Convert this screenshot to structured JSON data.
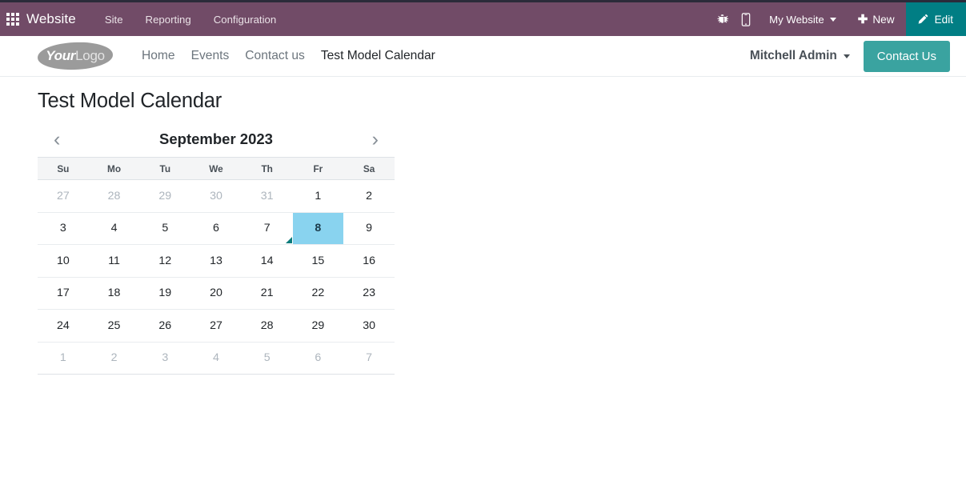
{
  "backend_navbar": {
    "apps_icon": "apps-grid-icon",
    "brand": "Website",
    "menu_items": [
      {
        "label": "Site"
      },
      {
        "label": "Reporting"
      },
      {
        "label": "Configuration"
      }
    ],
    "debug_icon": "bug-icon",
    "mobile_icon": "mobile-preview-icon",
    "website_switcher": "My Website",
    "new_label": "New",
    "new_icon": "plus-icon",
    "edit_label": "Edit",
    "edit_icon": "pencil-icon",
    "colors": {
      "navbar_bg": "#714B67",
      "edit_btn_bg": "#017e84"
    }
  },
  "site_header": {
    "logo_part1": "Your",
    "logo_part2": "Logo",
    "nav": [
      {
        "label": "Home",
        "active": false
      },
      {
        "label": "Events",
        "active": false
      },
      {
        "label": "Contact us",
        "active": false
      },
      {
        "label": "Test Model Calendar",
        "active": true
      }
    ],
    "user_name": "Mitchell Admin",
    "cta_label": "Contact Us",
    "colors": {
      "cta_bg": "#3aa3a0"
    }
  },
  "page": {
    "title": "Test Model Calendar"
  },
  "calendar": {
    "prev_icon": "chevron-left-icon",
    "next_icon": "chevron-right-icon",
    "month_label": "September 2023",
    "weekday_headers": [
      "Su",
      "Mo",
      "Tu",
      "We",
      "Th",
      "Fr",
      "Sa"
    ],
    "selected_day": 8,
    "selected_color": "#89d3ef",
    "marker_color": "#0b7b7b",
    "weeks": [
      [
        {
          "day": 27,
          "muted": true,
          "selected": false,
          "marker": false
        },
        {
          "day": 28,
          "muted": true,
          "selected": false,
          "marker": false
        },
        {
          "day": 29,
          "muted": true,
          "selected": false,
          "marker": false
        },
        {
          "day": 30,
          "muted": true,
          "selected": false,
          "marker": false
        },
        {
          "day": 31,
          "muted": true,
          "selected": false,
          "marker": false
        },
        {
          "day": 1,
          "muted": false,
          "selected": false,
          "marker": false
        },
        {
          "day": 2,
          "muted": false,
          "selected": false,
          "marker": false
        }
      ],
      [
        {
          "day": 3,
          "muted": false,
          "selected": false,
          "marker": false
        },
        {
          "day": 4,
          "muted": false,
          "selected": false,
          "marker": false
        },
        {
          "day": 5,
          "muted": false,
          "selected": false,
          "marker": false
        },
        {
          "day": 6,
          "muted": false,
          "selected": false,
          "marker": false
        },
        {
          "day": 7,
          "muted": false,
          "selected": false,
          "marker": true
        },
        {
          "day": 8,
          "muted": false,
          "selected": true,
          "marker": false
        },
        {
          "day": 9,
          "muted": false,
          "selected": false,
          "marker": false
        }
      ],
      [
        {
          "day": 10,
          "muted": false,
          "selected": false,
          "marker": false
        },
        {
          "day": 11,
          "muted": false,
          "selected": false,
          "marker": false
        },
        {
          "day": 12,
          "muted": false,
          "selected": false,
          "marker": false
        },
        {
          "day": 13,
          "muted": false,
          "selected": false,
          "marker": false
        },
        {
          "day": 14,
          "muted": false,
          "selected": false,
          "marker": false
        },
        {
          "day": 15,
          "muted": false,
          "selected": false,
          "marker": false
        },
        {
          "day": 16,
          "muted": false,
          "selected": false,
          "marker": false
        }
      ],
      [
        {
          "day": 17,
          "muted": false,
          "selected": false,
          "marker": false
        },
        {
          "day": 18,
          "muted": false,
          "selected": false,
          "marker": false
        },
        {
          "day": 19,
          "muted": false,
          "selected": false,
          "marker": false
        },
        {
          "day": 20,
          "muted": false,
          "selected": false,
          "marker": false
        },
        {
          "day": 21,
          "muted": false,
          "selected": false,
          "marker": false
        },
        {
          "day": 22,
          "muted": false,
          "selected": false,
          "marker": false
        },
        {
          "day": 23,
          "muted": false,
          "selected": false,
          "marker": false
        }
      ],
      [
        {
          "day": 24,
          "muted": false,
          "selected": false,
          "marker": false
        },
        {
          "day": 25,
          "muted": false,
          "selected": false,
          "marker": false
        },
        {
          "day": 26,
          "muted": false,
          "selected": false,
          "marker": false
        },
        {
          "day": 27,
          "muted": false,
          "selected": false,
          "marker": false
        },
        {
          "day": 28,
          "muted": false,
          "selected": false,
          "marker": false
        },
        {
          "day": 29,
          "muted": false,
          "selected": false,
          "marker": false
        },
        {
          "day": 30,
          "muted": false,
          "selected": false,
          "marker": false
        }
      ],
      [
        {
          "day": 1,
          "muted": true,
          "selected": false,
          "marker": false
        },
        {
          "day": 2,
          "muted": true,
          "selected": false,
          "marker": false
        },
        {
          "day": 3,
          "muted": true,
          "selected": false,
          "marker": false
        },
        {
          "day": 4,
          "muted": true,
          "selected": false,
          "marker": false
        },
        {
          "day": 5,
          "muted": true,
          "selected": false,
          "marker": false
        },
        {
          "day": 6,
          "muted": true,
          "selected": false,
          "marker": false
        },
        {
          "day": 7,
          "muted": true,
          "selected": false,
          "marker": false
        }
      ]
    ]
  }
}
